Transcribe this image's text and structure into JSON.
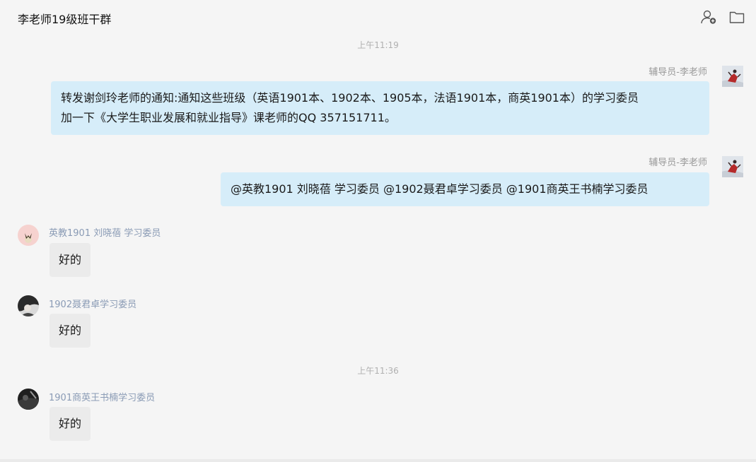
{
  "header": {
    "title": "李老师19级班干群"
  },
  "icons": {
    "add_member": "add-member-icon",
    "folder": "folder-icon"
  },
  "timestamps": [
    "上午11:19",
    "上午11:36"
  ],
  "messages": [
    {
      "sender": "辅导员-李老师",
      "line1": "转发谢剑玲老师的通知:通知这些班级（英语1901本、1902本、1905本，法语1901本，商英1901本）的学习委员",
      "line2": "加一下《大学生职业发展和就业指导》课老师的QQ 357151711。"
    },
    {
      "sender": "辅导员-李老师",
      "text": "@英教1901 刘晓蓓  学习委员 @1902聂君卓学习委员 @1901商英王书楠学习委员"
    },
    {
      "sender": "英教1901 刘晓蓓  学习委员",
      "text": "好的"
    },
    {
      "sender": "1902聂君卓学习委员",
      "text": "好的"
    },
    {
      "sender": "1901商英王书楠学习委员",
      "text": "好的"
    }
  ]
}
